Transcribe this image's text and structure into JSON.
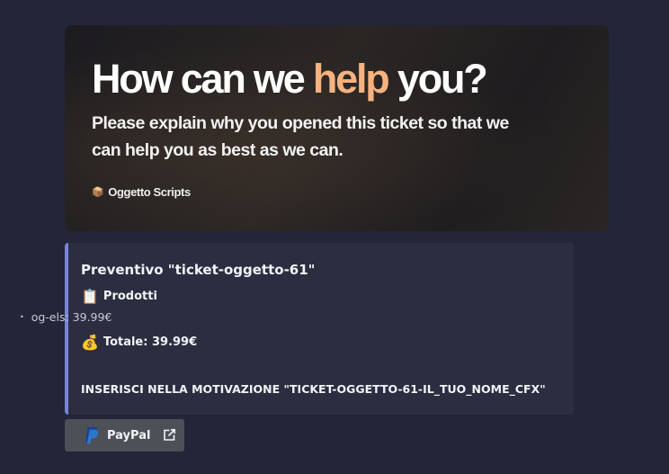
{
  "banner": {
    "headline_part1": "How can we ",
    "headline_highlight": "help",
    "headline_part2": " you?",
    "subtitle": "Please explain why you opened this ticket so that we can help you as best as we can.",
    "brand_icon": "📦",
    "brand_name": "Oggetto Scripts",
    "highlight_color": "#f6b27f"
  },
  "embed": {
    "accent_color": "#7984d9",
    "title": "Preventivo \"ticket-oggetto-61\"",
    "products_icon": "📋",
    "products_label": "Prodotti",
    "products": [
      {
        "bullet": "•",
        "text": "og-els: 39.99€"
      }
    ],
    "total_icon": "💰",
    "total_label": "Totale: 39.99€",
    "notice": "INSERISCI NELLA MOTIVAZIONE \"TICKET-OGGETTO-61-IL_TUO_NOME_CFX\""
  },
  "button": {
    "label": "PayPal",
    "icon": "paypal-icon",
    "trailing_icon": "external-link-icon"
  }
}
